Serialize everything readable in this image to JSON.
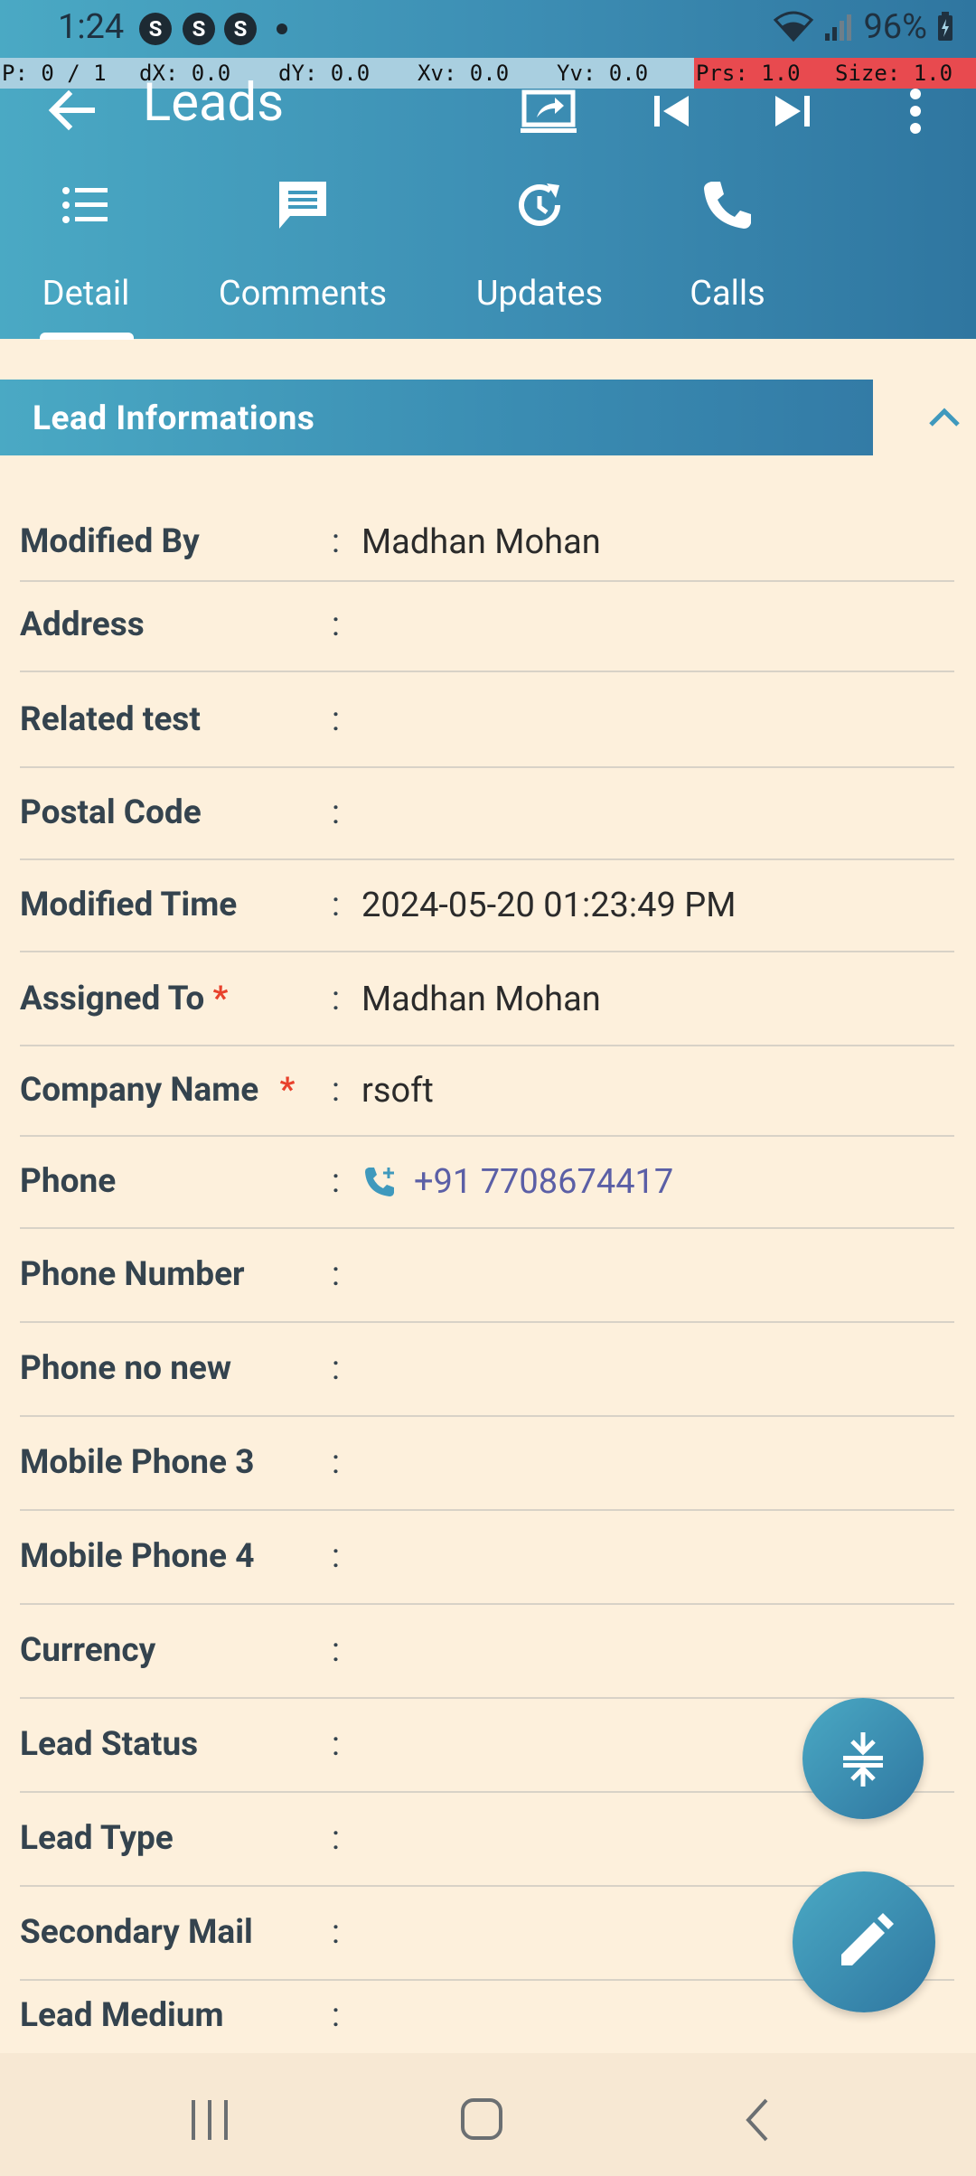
{
  "status_bar": {
    "time": "1:24",
    "app_icons": [
      "S",
      "S",
      "S"
    ],
    "battery": "96%"
  },
  "debug_bar": {
    "p": "P: 0 / 1",
    "dx": "dX: 0.0",
    "dy": "dY: 0.0",
    "xv": "Xv: 0.0",
    "yv": "Yv: 0.0",
    "prs": "Prs: 1.0",
    "size": "Size: 1.0"
  },
  "toolbar": {
    "title": "Leads",
    "icons": [
      "back-arrow-icon",
      "cast-icon",
      "skip-previous-icon",
      "skip-next-icon",
      "more-vert-icon"
    ]
  },
  "tabs": [
    {
      "label": "Detail",
      "icon": "list-icon",
      "active": true
    },
    {
      "label": "Comments",
      "icon": "comment-icon",
      "active": false
    },
    {
      "label": "Updates",
      "icon": "update-icon",
      "active": false
    },
    {
      "label": "Calls",
      "icon": "phone-icon",
      "active": false
    }
  ],
  "section": {
    "title": "Lead Informations",
    "collapse_icon": "chevron-up-icon"
  },
  "fields": [
    {
      "label": "Modified By",
      "required": false,
      "value": "Madhan Mohan"
    },
    {
      "label": "Address",
      "required": false,
      "value": ""
    },
    {
      "label": "Related test",
      "required": false,
      "value": ""
    },
    {
      "label": " Postal Code",
      "required": false,
      "value": ""
    },
    {
      "label": "Modified Time",
      "required": false,
      "value": "2024-05-20 01:23:49 PM"
    },
    {
      "label": "Assigned To ",
      "required": true,
      "value": "Madhan Mohan"
    },
    {
      "label": "Company Name ",
      "required": true,
      "value": "rsoft"
    },
    {
      "label": "Phone",
      "required": false,
      "value": "+91 7708674417"
    },
    {
      "label": "Phone Number",
      "required": false,
      "value": ""
    },
    {
      "label": "Phone no new",
      "required": false,
      "value": ""
    },
    {
      "label": "Mobile Phone 3",
      "required": false,
      "value": ""
    },
    {
      "label": "Mobile Phone 4",
      "required": false,
      "value": ""
    },
    {
      "label": "Currency",
      "required": false,
      "value": ""
    },
    {
      "label": "Lead Status",
      "required": false,
      "value": ""
    },
    {
      "label": "Lead Type",
      "required": false,
      "value": ""
    },
    {
      "label": "Secondary Mail",
      "required": false,
      "value": ""
    },
    {
      "label": "Lead Medium",
      "required": false,
      "value": ""
    }
  ],
  "colon": ":",
  "required_mark": "*",
  "fabs": [
    "collapse-all-icon",
    "edit-icon"
  ],
  "nav": [
    "recents-icon",
    "home-icon",
    "back-icon"
  ],
  "colors": {
    "header_start": "#4aa9c4",
    "header_end": "#2f76a0",
    "background": "#fdf0dc",
    "required": "#e8412c",
    "phone_link": "#5b5fa6"
  }
}
